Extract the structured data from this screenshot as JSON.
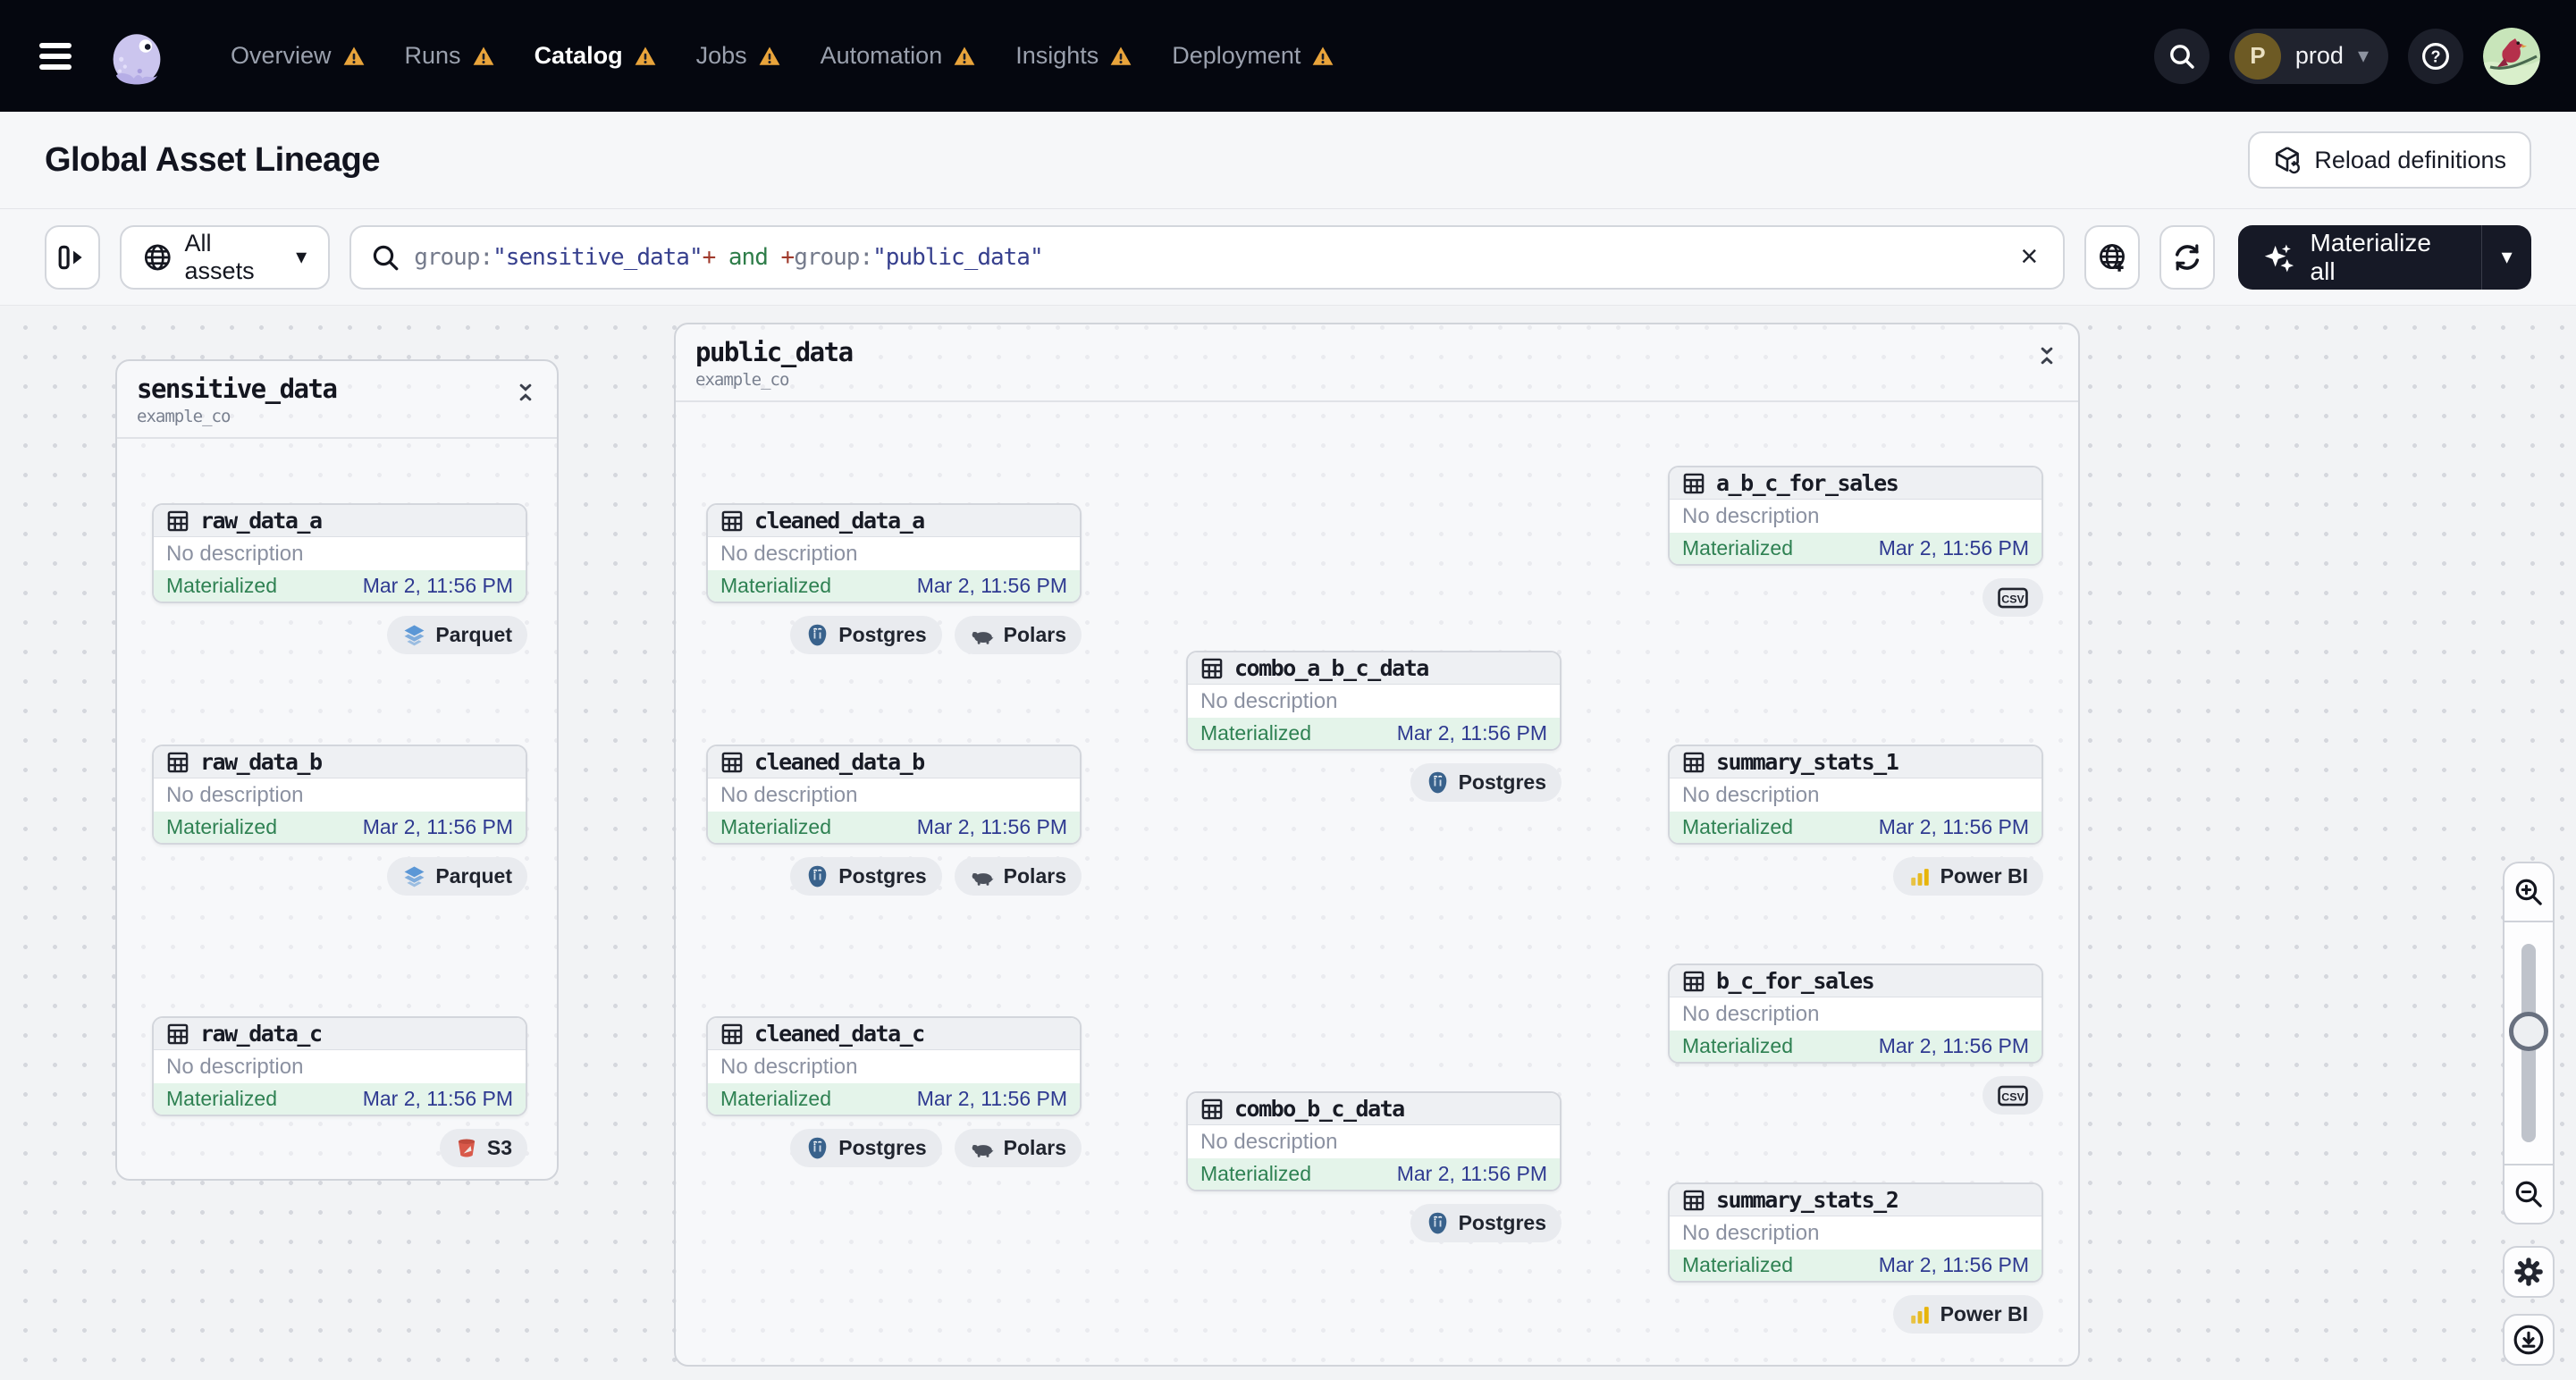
{
  "nav": {
    "items": [
      {
        "label": "Overview",
        "active": false,
        "warning": false
      },
      {
        "label": "Runs",
        "active": false,
        "warning": false
      },
      {
        "label": "Catalog",
        "active": true,
        "warning": false
      },
      {
        "label": "Jobs",
        "active": false,
        "warning": false
      },
      {
        "label": "Automation",
        "active": false,
        "warning": false
      },
      {
        "label": "Insights",
        "active": false,
        "warning": false
      },
      {
        "label": "Deployment",
        "active": false,
        "warning": true
      }
    ],
    "environment": {
      "initial": "P",
      "name": "prod"
    },
    "icons": [
      "hamburger-icon",
      "dagster-logo",
      "search-icon",
      "help-icon",
      "user-avatar"
    ]
  },
  "header": {
    "title": "Global Asset Lineage",
    "reload_button": "Reload definitions"
  },
  "toolbar": {
    "scope_button": "All assets",
    "query": {
      "segments": [
        {
          "text": "group:",
          "color": "#757b8c"
        },
        {
          "text": "\"sensitive_data\"",
          "color": "#363f8d"
        },
        {
          "text": "+",
          "color": "#a03a2c"
        },
        {
          "text": " and ",
          "color": "#2e7d49"
        },
        {
          "text": "+",
          "color": "#a03a2c"
        },
        {
          "text": "group:",
          "color": "#757b8c"
        },
        {
          "text": "\"public_data\"",
          "color": "#363f8d"
        }
      ]
    },
    "materialize_button": "Materialize all"
  },
  "graph": {
    "groups": [
      {
        "id": "sensitive_data",
        "name": "sensitive_data",
        "location": "example_co"
      },
      {
        "id": "public_data",
        "name": "public_data",
        "location": "example_co"
      }
    ],
    "nodes": [
      {
        "id": "raw_data_a",
        "name": "raw_data_a",
        "description": "No description",
        "status": "Materialized",
        "timestamp": "Mar 2, 11:56 PM",
        "tags": [
          {
            "label": "Parquet",
            "icon": "parquet-icon"
          }
        ]
      },
      {
        "id": "raw_data_b",
        "name": "raw_data_b",
        "description": "No description",
        "status": "Materialized",
        "timestamp": "Mar 2, 11:56 PM",
        "tags": [
          {
            "label": "Parquet",
            "icon": "parquet-icon"
          }
        ]
      },
      {
        "id": "raw_data_c",
        "name": "raw_data_c",
        "description": "No description",
        "status": "Materialized",
        "timestamp": "Mar 2, 11:56 PM",
        "tags": [
          {
            "label": "S3",
            "icon": "s3-icon"
          }
        ]
      },
      {
        "id": "cleaned_data_a",
        "name": "cleaned_data_a",
        "description": "No description",
        "status": "Materialized",
        "timestamp": "Mar 2, 11:56 PM",
        "tags": [
          {
            "label": "Postgres",
            "icon": "postgres-icon"
          },
          {
            "label": "Polars",
            "icon": "polars-icon"
          }
        ]
      },
      {
        "id": "cleaned_data_b",
        "name": "cleaned_data_b",
        "description": "No description",
        "status": "Materialized",
        "timestamp": "Mar 2, 11:56 PM",
        "tags": [
          {
            "label": "Postgres",
            "icon": "postgres-icon"
          },
          {
            "label": "Polars",
            "icon": "polars-icon"
          }
        ]
      },
      {
        "id": "cleaned_data_c",
        "name": "cleaned_data_c",
        "description": "No description",
        "status": "Materialized",
        "timestamp": "Mar 2, 11:56 PM",
        "tags": [
          {
            "label": "Postgres",
            "icon": "postgres-icon"
          },
          {
            "label": "Polars",
            "icon": "polars-icon"
          }
        ]
      },
      {
        "id": "combo_a_b_c_data",
        "name": "combo_a_b_c_data",
        "description": "No description",
        "status": "Materialized",
        "timestamp": "Mar 2, 11:56 PM",
        "tags": [
          {
            "label": "Postgres",
            "icon": "postgres-icon"
          }
        ]
      },
      {
        "id": "combo_b_c_data",
        "name": "combo_b_c_data",
        "description": "No description",
        "status": "Materialized",
        "timestamp": "Mar 2, 11:56 PM",
        "tags": [
          {
            "label": "Postgres",
            "icon": "postgres-icon"
          }
        ]
      },
      {
        "id": "a_b_c_for_sales",
        "name": "a_b_c_for_sales",
        "description": "No description",
        "status": "Materialized",
        "timestamp": "Mar 2, 11:56 PM",
        "tags": [
          {
            "label": "",
            "icon": "csv-icon"
          }
        ]
      },
      {
        "id": "summary_stats_1",
        "name": "summary_stats_1",
        "description": "No description",
        "status": "Materialized",
        "timestamp": "Mar 2, 11:56 PM",
        "tags": [
          {
            "label": "Power BI",
            "icon": "powerbi-icon"
          }
        ]
      },
      {
        "id": "b_c_for_sales",
        "name": "b_c_for_sales",
        "description": "No description",
        "status": "Materialized",
        "timestamp": "Mar 2, 11:56 PM",
        "tags": [
          {
            "label": "",
            "icon": "csv-icon"
          }
        ]
      },
      {
        "id": "summary_stats_2",
        "name": "summary_stats_2",
        "description": "No description",
        "status": "Materialized",
        "timestamp": "Mar 2, 11:56 PM",
        "tags": [
          {
            "label": "Power BI",
            "icon": "powerbi-icon"
          }
        ]
      }
    ],
    "edges": [
      {
        "from": "raw_data_a",
        "to": "cleaned_data_a"
      },
      {
        "from": "raw_data_b",
        "to": "cleaned_data_b"
      },
      {
        "from": "raw_data_c",
        "to": "cleaned_data_c"
      },
      {
        "from": "cleaned_data_a",
        "to": "combo_a_b_c_data"
      },
      {
        "from": "cleaned_data_b",
        "to": "combo_a_b_c_data"
      },
      {
        "from": "cleaned_data_b",
        "to": "combo_b_c_data"
      },
      {
        "from": "cleaned_data_c",
        "to": "combo_b_c_data"
      },
      {
        "from": "combo_a_b_c_data",
        "to": "a_b_c_for_sales"
      },
      {
        "from": "combo_a_b_c_data",
        "to": "summary_stats_1"
      },
      {
        "from": "combo_b_c_data",
        "to": "b_c_for_sales"
      },
      {
        "from": "combo_b_c_data",
        "to": "summary_stats_2"
      }
    ]
  },
  "zoom_controls": {
    "icons": [
      "zoom-in-icon",
      "zoom-slider",
      "zoom-out-icon",
      "gear-icon",
      "download-icon"
    ]
  },
  "colors": {
    "nav_bg": "#05070f",
    "accent_warning": "#e9a43b",
    "status_green": "#2e8152",
    "timestamp_indigo": "#2f3a91",
    "edge_gray": "#d4d6dc",
    "materialize_bg": "#161926"
  }
}
